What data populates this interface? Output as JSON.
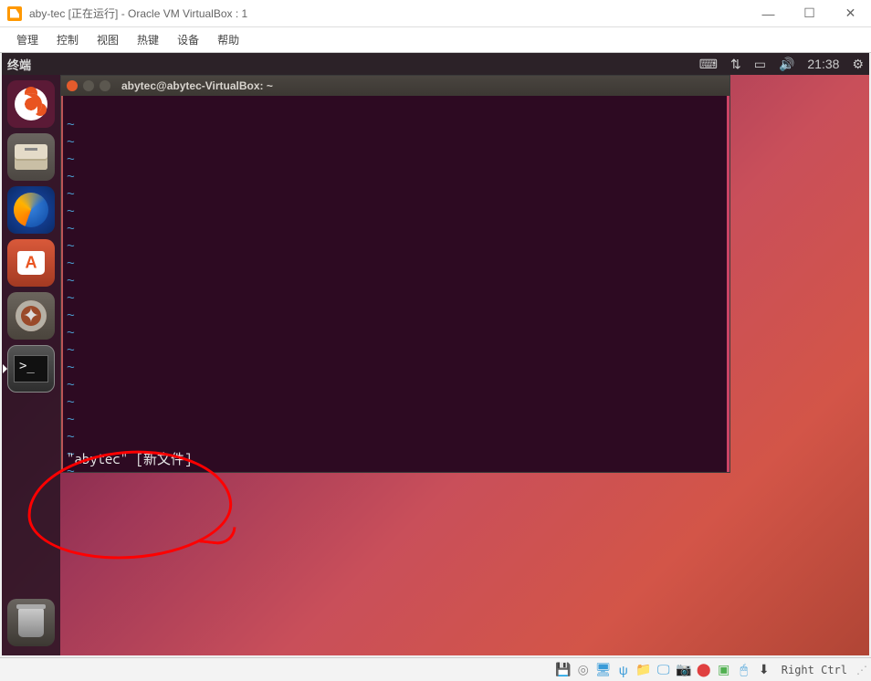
{
  "vbox": {
    "title": "aby-tec [正在运行] - Oracle VM VirtualBox : 1",
    "menu": [
      "管理",
      "控制",
      "视图",
      "热键",
      "设备",
      "帮助"
    ],
    "win": {
      "min": "—",
      "max": "☐",
      "close": "✕"
    },
    "status": {
      "hostkey": "Right Ctrl"
    }
  },
  "ubuntu": {
    "panel_app": "终端",
    "clock": "21:38",
    "launcher": [
      "dash",
      "files",
      "firefox",
      "software",
      "settings",
      "terminal"
    ],
    "trash": "trash"
  },
  "terminal": {
    "title": "abytec@abytec-VirtualBox: ~",
    "tilde_lines": 21,
    "status_line": "\"abytec\" [新文件]"
  }
}
